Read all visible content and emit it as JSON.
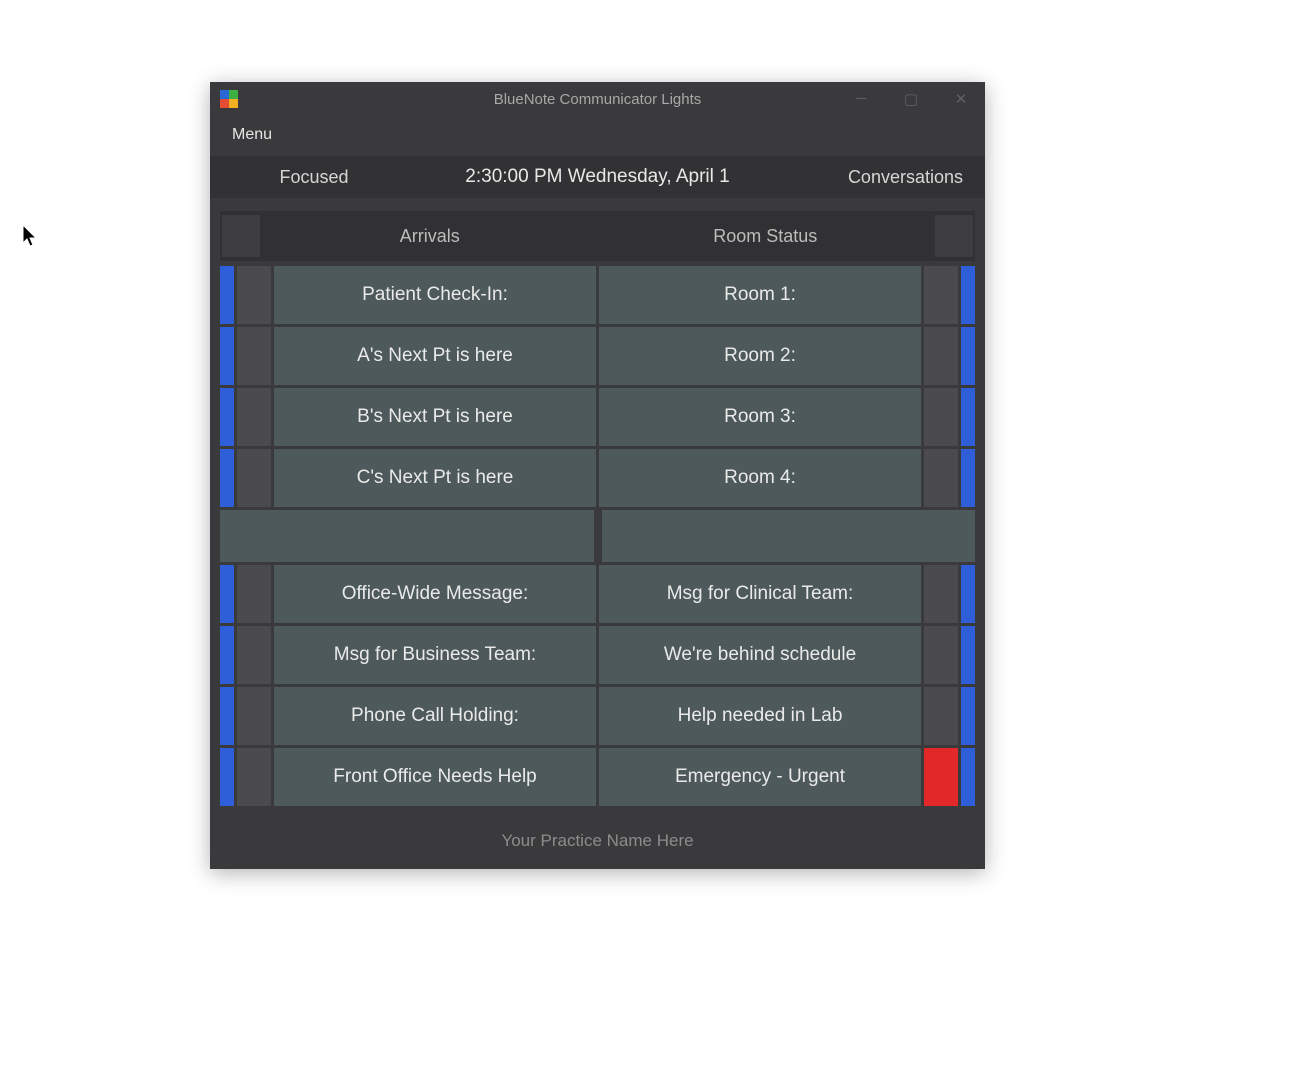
{
  "window": {
    "title": "BlueNote Communicator Lights",
    "menu_label": "Menu"
  },
  "infobar": {
    "focused_label": "Focused",
    "datetime": "2:30:00 PM  Wednesday, April 1",
    "conversations_label": "Conversations"
  },
  "columns": {
    "left_header": "Arrivals",
    "right_header": "Room Status"
  },
  "rows_top": [
    {
      "left": "Patient Check-In:",
      "right": "Room 1:"
    },
    {
      "left": "A's Next Pt is here",
      "right": "Room 2:"
    },
    {
      "left": "B's Next Pt is here",
      "right": "Room 3:"
    },
    {
      "left": "C's Next Pt is here",
      "right": "Room 4:"
    }
  ],
  "rows_bottom": [
    {
      "left": "Office-Wide Message:",
      "right": "Msg for Clinical Team:",
      "right_mini_color": "default"
    },
    {
      "left": "Msg for Business Team:",
      "right": "We're behind schedule",
      "right_mini_color": "default"
    },
    {
      "left": "Phone Call Holding:",
      "right": "Help needed in Lab",
      "right_mini_color": "default"
    },
    {
      "left": "Front Office Needs Help",
      "right": "Emergency - Urgent",
      "right_mini_color": "red"
    }
  ],
  "footer": {
    "practice_name": "Your Practice Name Here"
  },
  "colors": {
    "stripe_blue": "#2e5fd8",
    "mini_red": "#e22828"
  }
}
